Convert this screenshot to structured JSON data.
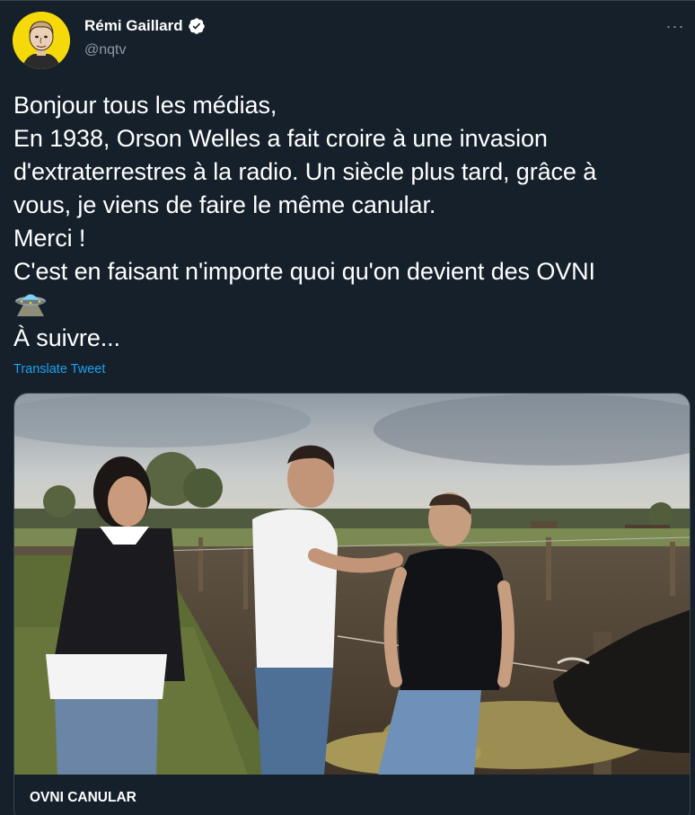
{
  "author": {
    "display_name": "Rémi Gaillard",
    "handle": "@nqtv",
    "verified": true,
    "avatar_bg": "#f5d90a"
  },
  "more_button": {
    "label": "···",
    "icon": "more-horizontal-icon"
  },
  "tweet": {
    "lines": [
      "Bonjour tous les médias,",
      "En 1938, Orson Welles a fait croire à une invasion",
      "d'extraterrestres à la radio. Un siècle plus tard, grâce à",
      "vous, je viens de faire le même canular.",
      "Merci !",
      "C'est en faisant n'importe quoi qu'on devient des OVNI"
    ],
    "emoji": "flying-saucer-icon",
    "last_line": "À suivre..."
  },
  "translate_label": "Translate Tweet",
  "card": {
    "title": "OVNI CANULAR"
  },
  "colors": {
    "background": "#15202b",
    "border": "#38444d",
    "secondary_text": "#8899a6",
    "link": "#1da1f2"
  }
}
